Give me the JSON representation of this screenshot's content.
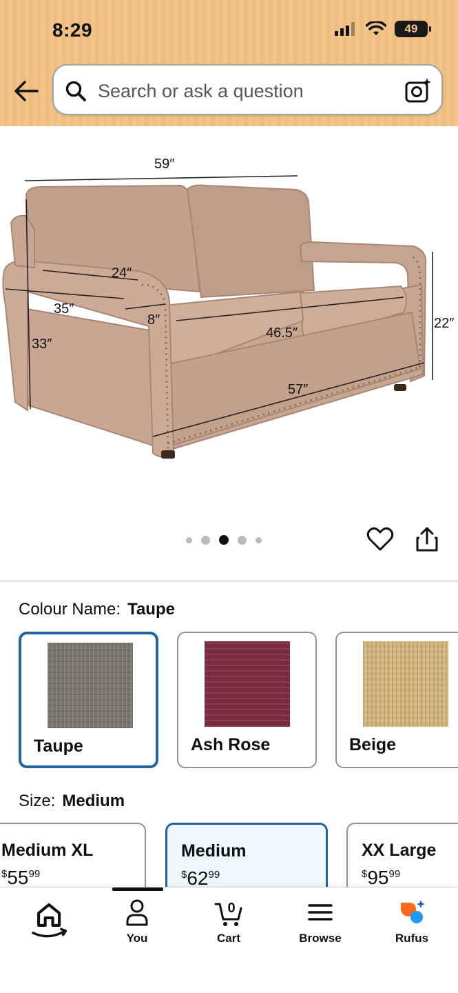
{
  "status_bar": {
    "time": "8:29",
    "battery": "49"
  },
  "search": {
    "placeholder": "Search or ask a question"
  },
  "product_image": {
    "dimensions": [
      "59″",
      "24″",
      "35″",
      "8″",
      "33″",
      "46.5″",
      "22″",
      "57″"
    ],
    "carousel_dots": 5,
    "active_dot": 3
  },
  "colour": {
    "label": "Colour Name:",
    "selected": "Taupe",
    "options": [
      {
        "name": "Taupe",
        "color": "#7b746d"
      },
      {
        "name": "Ash Rose",
        "color": "#7a2840"
      },
      {
        "name": "Beige",
        "color": "#d4b57a"
      }
    ]
  },
  "size": {
    "label": "Size:",
    "selected": "Medium",
    "options": [
      {
        "name": "Medium XL",
        "price_symbol": "$",
        "price_whole": "55",
        "price_fraction": "99"
      },
      {
        "name": "Medium",
        "price_symbol": "$",
        "price_whole": "62",
        "price_fraction": "99"
      },
      {
        "name": "XX Large",
        "price_symbol": "$",
        "price_whole": "95",
        "price_fraction": "99"
      }
    ]
  },
  "bottom_nav": {
    "items": [
      {
        "label": "",
        "icon": "home-icon"
      },
      {
        "label": "You",
        "icon": "person-icon"
      },
      {
        "label": "Cart",
        "icon": "cart-icon",
        "badge": "0"
      },
      {
        "label": "Browse",
        "icon": "menu-icon"
      },
      {
        "label": "Rufus",
        "icon": "rufus-icon"
      }
    ]
  },
  "colors": {
    "accent": "#2162a1",
    "header": "#f3c48a",
    "sofa": "#c9a693"
  }
}
